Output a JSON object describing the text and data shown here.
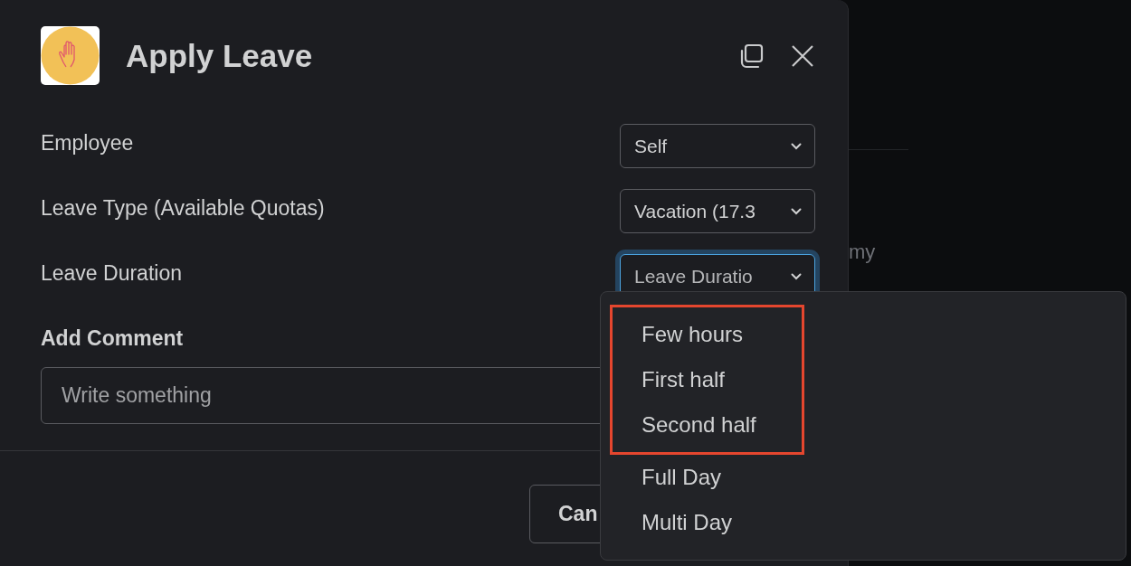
{
  "background": {
    "text": "my"
  },
  "dialog": {
    "title": "Apply Leave",
    "fields": [
      {
        "label": "Employee",
        "value": "Self",
        "focused": false
      },
      {
        "label": "Leave Type (Available Quotas)",
        "value": "Vacation (17.3",
        "focused": false
      },
      {
        "label": "Leave Duration",
        "placeholder": "Leave Duratio",
        "focused": true
      }
    ],
    "comment": {
      "label": "Add Comment",
      "placeholder": "Write something"
    },
    "buttons": [
      "Can"
    ]
  },
  "menu": {
    "options": [
      {
        "label": "Few hours",
        "highlighted": true
      },
      {
        "label": "First half",
        "highlighted": true
      },
      {
        "label": "Second half",
        "highlighted": true
      },
      {
        "label": "Full Day",
        "highlighted": false
      },
      {
        "label": "Multi Day",
        "highlighted": false
      }
    ]
  }
}
